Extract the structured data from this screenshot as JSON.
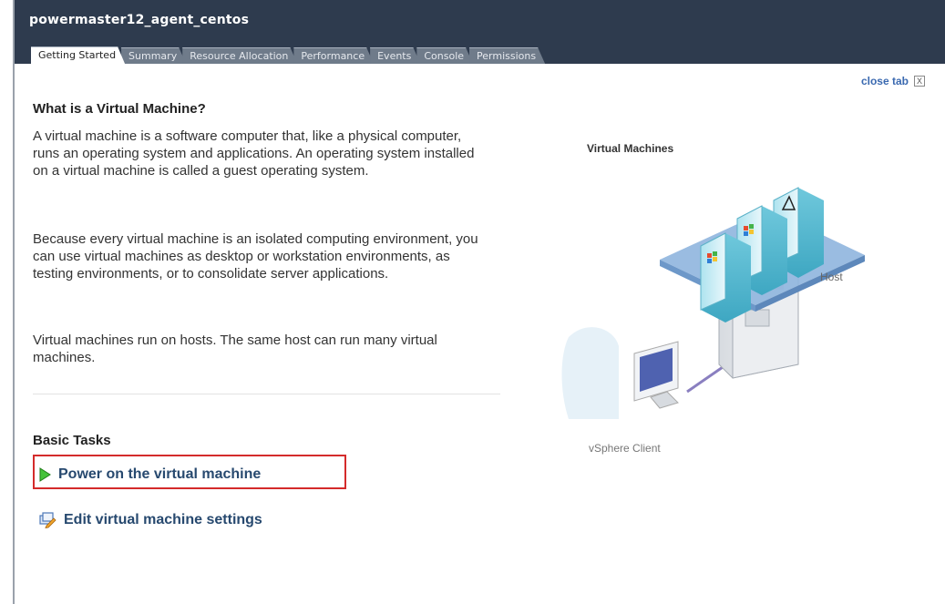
{
  "window": {
    "vm_name": "powermaster12_agent_centos"
  },
  "tabs": [
    {
      "label": "Getting Started",
      "active": true
    },
    {
      "label": "Summary"
    },
    {
      "label": "Resource Allocation"
    },
    {
      "label": "Performance"
    },
    {
      "label": "Events"
    },
    {
      "label": "Console"
    },
    {
      "label": "Permissions"
    }
  ],
  "close_tab": {
    "label": "close tab",
    "box": "X"
  },
  "intro": {
    "heading": "What is a Virtual Machine?",
    "paragraphs": [
      "A virtual machine is a software computer that, like a physical computer, runs an operating system and applications. An operating system installed on a virtual machine is called a guest operating system.",
      "Because every virtual machine is an isolated computing environment, you can use virtual machines as desktop or workstation environments, as testing environments, or to consolidate server applications.",
      "Virtual machines run on hosts. The same host can run many virtual machines."
    ]
  },
  "diagram": {
    "label_vms": "Virtual Machines",
    "label_host": "Host",
    "label_client": "vSphere Client"
  },
  "basic_tasks": {
    "heading": "Basic Tasks",
    "items": [
      {
        "label": "Power on the virtual machine",
        "icon": "play-icon",
        "color": "#3bbf2e"
      },
      {
        "label": "Edit virtual machine settings",
        "icon": "edit-settings-icon"
      }
    ]
  },
  "colors": {
    "titlebar": "#2e3b4e",
    "link": "#27496f",
    "highlight": "#d42b2b"
  }
}
